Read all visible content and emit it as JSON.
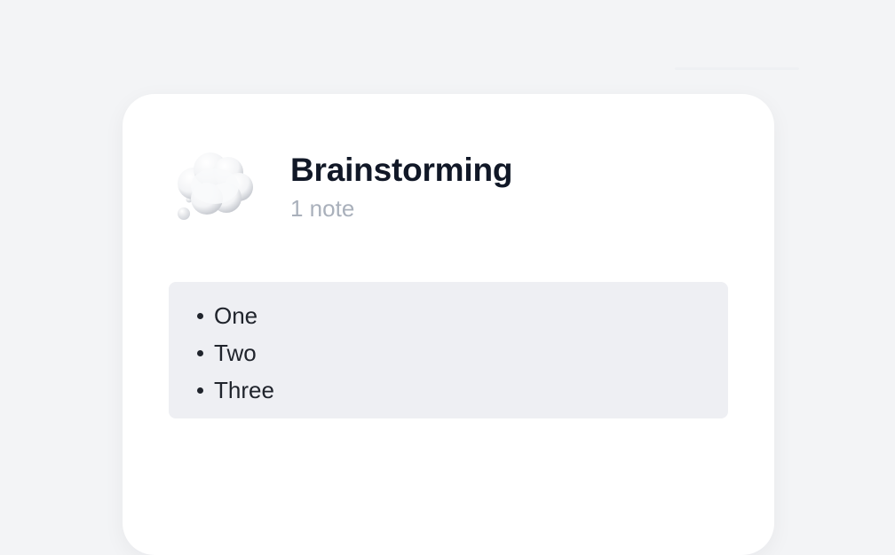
{
  "window": {
    "background_color": "#f3f4f6",
    "card_color": "#ffffff"
  },
  "collection": {
    "icon": "thought-balloon-icon",
    "title": "Brainstorming",
    "subtitle": "1 note"
  },
  "note": {
    "background_color": "#eeeff3",
    "items": [
      {
        "text": "One"
      },
      {
        "text": "Two"
      },
      {
        "text": "Three"
      }
    ]
  }
}
